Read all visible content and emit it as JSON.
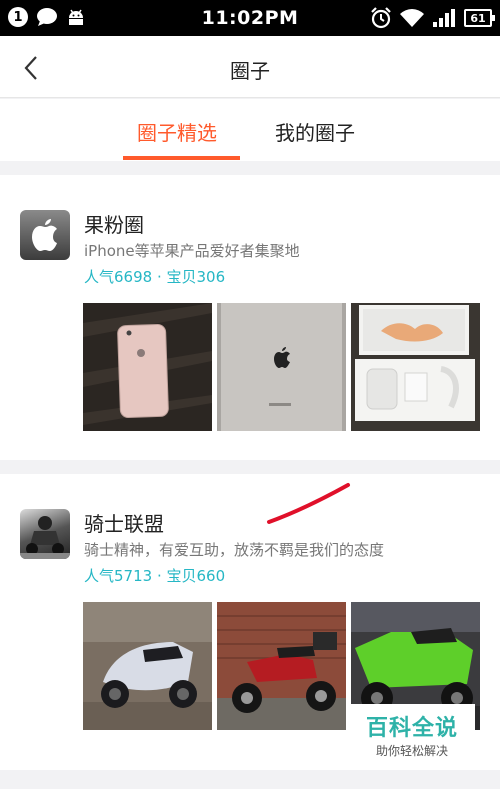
{
  "status_bar": {
    "notification_count": "1",
    "time": "11:02PM",
    "battery": "61"
  },
  "nav": {
    "title": "圈子"
  },
  "tabs": [
    {
      "label": "圈子精选",
      "active": true
    },
    {
      "label": "我的圈子",
      "active": false
    }
  ],
  "circles": [
    {
      "name": "果粉圈",
      "description": "iPhone等苹果产品爱好者集聚地",
      "stats": "人气6698 · 宝贝306",
      "avatar_icon": "apple-logo-icon"
    },
    {
      "name": "骑士联盟",
      "description": "骑士精神，有爱互助，放荡不羁是我们的态度",
      "stats": "人气5713 · 宝贝660",
      "avatar_icon": "motorcycle-rider-icon"
    }
  ],
  "watermark": {
    "title": "百科全说",
    "subtitle": "助你轻松解决"
  },
  "colors": {
    "accent": "#ff5a2c",
    "stats": "#26b7c5",
    "watermark": "#2eb2a8",
    "annotation": "#e0102a"
  }
}
